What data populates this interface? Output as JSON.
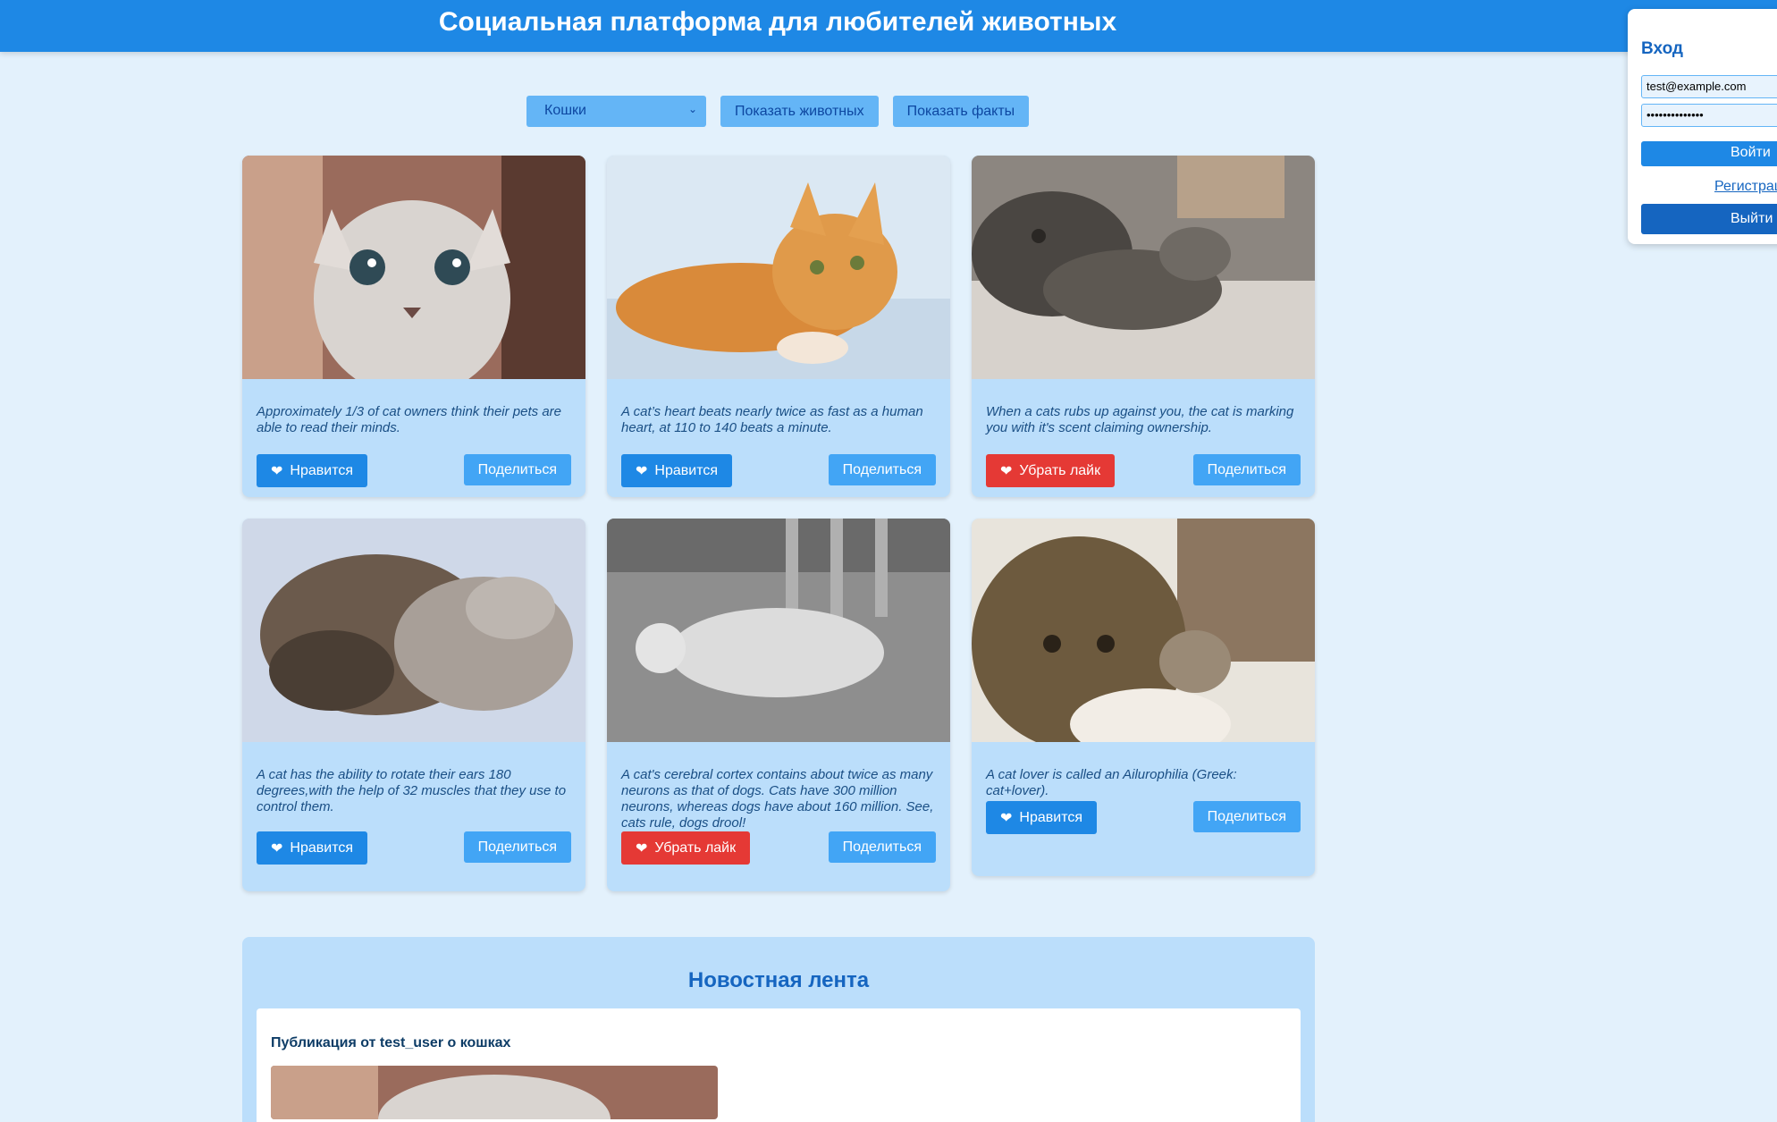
{
  "header": {
    "title": "Социальная платформа для любителей животных"
  },
  "controls": {
    "select_value": "Кошки",
    "show_animals": "Показать животных",
    "show_facts": "Показать факты"
  },
  "cards": [
    {
      "fact": "Approximately 1/3 of cat owners think their pets are able to read their minds.",
      "like": "Нравится",
      "share": "Поделиться"
    },
    {
      "fact": "A cat’s heart beats nearly twice as fast as a human heart, at 110 to 140 beats a minute.",
      "like": "Нравится",
      "share": "Поделиться"
    },
    {
      "fact": "When a cats rubs up against you, the cat is marking you with it's scent claiming ownership.",
      "like": "Убрать лайк",
      "share": "Поделиться"
    },
    {
      "fact": "A cat has the ability to rotate their ears 180 degrees,with the help of 32 muscles that they use to control them.",
      "like": "Нравится",
      "share": "Поделиться"
    },
    {
      "fact": "A cat's cerebral cortex contains about twice as many neurons as that of dogs. Cats have 300 million neurons, whereas dogs have about 160 million. See, cats rule, dogs drool!",
      "like": "Убрать лайк",
      "share": "Поделиться"
    },
    {
      "fact": "A cat lover is called an Ailurophilia (Greek: cat+lover).",
      "like": "Нравится",
      "share": "Поделиться"
    }
  ],
  "news": {
    "title": "Новостная лента",
    "post_title": "Публикация от test_user о кошках"
  },
  "login": {
    "title": "Вход",
    "email": "test@example.com",
    "password": "••••••••••••••",
    "login_btn": "Войти",
    "register": "Регистрация",
    "logout_btn": "Выйти"
  },
  "colors": {
    "primary": "#1e88e5",
    "liked": "#e53935",
    "card": "#bbdefb",
    "bg": "#e3f1fc"
  }
}
